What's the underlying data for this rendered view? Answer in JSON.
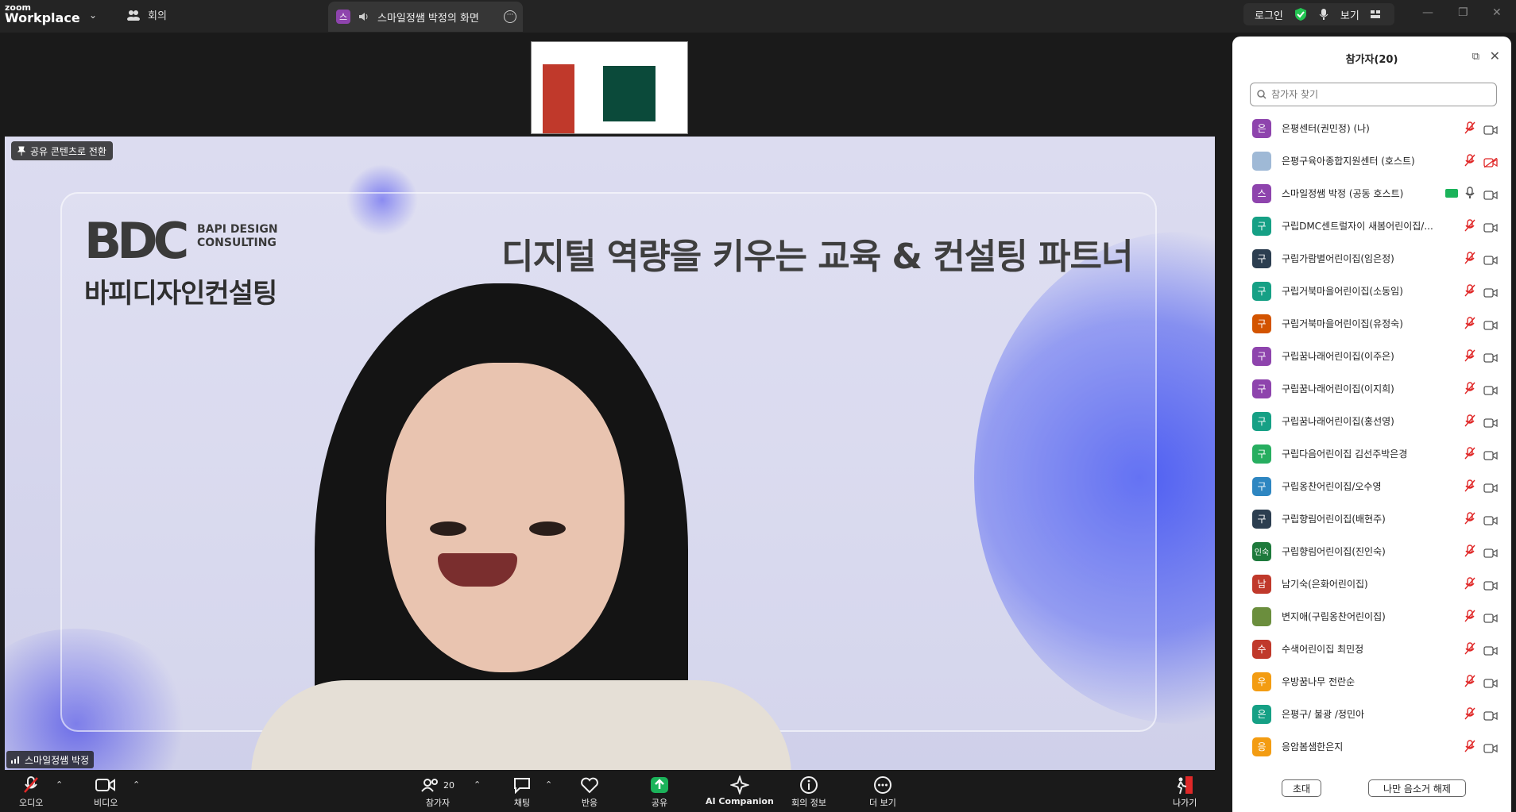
{
  "app": {
    "brand_top": "zoom",
    "brand_name": "Workplace"
  },
  "topbar": {
    "meeting_tab": "회의",
    "share_tab": {
      "avatar": "스",
      "label": "스마일정쌤 박정의 화면"
    },
    "login": "로그인",
    "view": "보기"
  },
  "stage": {
    "pin_button": "공유 콘텐츠로 전환",
    "name_tag": "스마일정쌤 박정",
    "logo_mark": "BDC",
    "logo_sub": "BAPI DESIGN CONSULTING",
    "logo_kr": "바피디자인컨설팅",
    "headline": "디지털 역량을 키우는 교육 & 컨설팅 파트너"
  },
  "toolbar": {
    "audio": "오디오",
    "video": "비디오",
    "participants": "참가자",
    "participants_count": "20",
    "chat": "채팅",
    "reactions": "반응",
    "share": "공유",
    "ai": "AI Companion",
    "info": "회의 정보",
    "more": "더 보기",
    "leave": "나가기"
  },
  "panel": {
    "title": "참가자(20)",
    "search_placeholder": "참가자 찾기",
    "participants": [
      {
        "avatar": "은",
        "color": "#8e44ad",
        "name": "은평센터(권민정) (나)",
        "mic": "muted",
        "cam": "off"
      },
      {
        "avatar": "",
        "color": "#9fb9d6",
        "name": "은평구육아종합지원센터 (호스트)",
        "mic": "muted",
        "cam": "off-red"
      },
      {
        "avatar": "스",
        "color": "#8e44ad",
        "name": "스마일정쌤 박정 (공동 호스트)",
        "mic": "on",
        "cam": "on",
        "sharing": true
      },
      {
        "avatar": "구",
        "color": "#16a085",
        "name": "구립DMC센트럴자이 새봄어린이집/...",
        "mic": "muted",
        "cam": "off"
      },
      {
        "avatar": "구",
        "color": "#2c3e50",
        "name": "구립가람별어린이집(임은정)",
        "mic": "muted",
        "cam": "off"
      },
      {
        "avatar": "구",
        "color": "#16a085",
        "name": "구립거북마을어린이집(소동임)",
        "mic": "muted",
        "cam": "off"
      },
      {
        "avatar": "구",
        "color": "#d35400",
        "name": "구립거북마을어린이집(유정숙)",
        "mic": "muted",
        "cam": "off"
      },
      {
        "avatar": "구",
        "color": "#8e44ad",
        "name": "구립꿈나래어린이집(이주은)",
        "mic": "muted",
        "cam": "off"
      },
      {
        "avatar": "구",
        "color": "#8e44ad",
        "name": "구립꿈나래어린이집(이지희)",
        "mic": "muted",
        "cam": "off"
      },
      {
        "avatar": "구",
        "color": "#16a085",
        "name": "구립꿈나래어린이집(홍선영)",
        "mic": "muted",
        "cam": "off"
      },
      {
        "avatar": "구",
        "color": "#27ae60",
        "name": "구립다음어린이집 김선주박은경",
        "mic": "muted",
        "cam": "off"
      },
      {
        "avatar": "구",
        "color": "#2e86c1",
        "name": "구립옹찬어린이집/오수영",
        "mic": "muted",
        "cam": "off"
      },
      {
        "avatar": "구",
        "color": "#2c3e50",
        "name": "구립향림어린이집(배현주)",
        "mic": "muted",
        "cam": "off"
      },
      {
        "avatar": "인숙",
        "color": "#1e7a3c",
        "name": "구립향림어린이집(진인숙)",
        "mic": "muted",
        "cam": "off"
      },
      {
        "avatar": "남",
        "color": "#c0392b",
        "name": "남기숙(은화어린이집)",
        "mic": "muted",
        "cam": "off"
      },
      {
        "avatar": "",
        "color": "#6b8e3d",
        "name": "변지애(구립옹찬어린이집)",
        "mic": "muted",
        "cam": "off"
      },
      {
        "avatar": "수",
        "color": "#c0392b",
        "name": "수색어린이집 최민정",
        "mic": "muted",
        "cam": "off"
      },
      {
        "avatar": "우",
        "color": "#f39c12",
        "name": "우방꿈나무 전란순",
        "mic": "muted",
        "cam": "off"
      },
      {
        "avatar": "은",
        "color": "#16a085",
        "name": "은평구/ 불광 /정민아",
        "mic": "muted",
        "cam": "off"
      },
      {
        "avatar": "응",
        "color": "#f39c12",
        "name": "응암봄샘한은지",
        "mic": "muted",
        "cam": "off"
      }
    ],
    "invite_button": "초대",
    "unmute_me_button": "나만 음소거 해제"
  }
}
